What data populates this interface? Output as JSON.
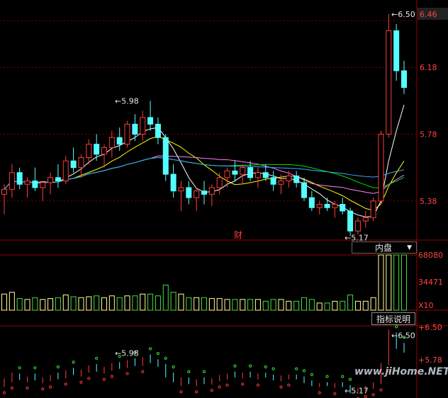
{
  "price_panel": {
    "y_labels": [
      "6.46",
      "6.18",
      "5.78",
      "5.38"
    ],
    "current_label": "6.46",
    "high_annotation": "6.50",
    "peak_annotation": "5.98",
    "low_annotation": "5.17",
    "marker": "财"
  },
  "volume_panel": {
    "dropdown_label": "内盘",
    "y_labels": [
      "68080",
      "34471"
    ],
    "unit": "X10"
  },
  "indicator_panel": {
    "help_button": "指标说明",
    "y_labels": [
      "+6.50",
      "+5.78"
    ],
    "high_annotation": "6.50",
    "peak_annotation": "5.98",
    "low_annotation": "5.17"
  },
  "watermark": "www.jiHome.NET",
  "colors": {
    "up": "#ff3c3c",
    "down": "#54ffff",
    "ma5": "#ffffff",
    "ma10": "#ffff00",
    "ma20": "#ff80ff",
    "ma30": "#00e000",
    "ma60": "#3fa9ff",
    "grid": "#7a0000",
    "vol_up": "#ffff99",
    "vol_down": "#44dd44"
  },
  "chart_data": {
    "type": "candlestick",
    "ylim": [
      5.15,
      6.55
    ],
    "candles": [
      [
        5.42,
        5.48,
        5.3,
        5.45
      ],
      [
        5.45,
        5.6,
        5.4,
        5.55
      ],
      [
        5.55,
        5.58,
        5.45,
        5.48
      ],
      [
        5.48,
        5.52,
        5.4,
        5.5
      ],
      [
        5.5,
        5.58,
        5.44,
        5.46
      ],
      [
        5.46,
        5.5,
        5.38,
        5.49
      ],
      [
        5.49,
        5.55,
        5.42,
        5.52
      ],
      [
        5.52,
        5.6,
        5.46,
        5.5
      ],
      [
        5.5,
        5.65,
        5.48,
        5.62
      ],
      [
        5.62,
        5.7,
        5.55,
        5.58
      ],
      [
        5.58,
        5.66,
        5.52,
        5.64
      ],
      [
        5.64,
        5.75,
        5.6,
        5.72
      ],
      [
        5.72,
        5.78,
        5.62,
        5.66
      ],
      [
        5.66,
        5.72,
        5.58,
        5.7
      ],
      [
        5.7,
        5.8,
        5.64,
        5.76
      ],
      [
        5.76,
        5.82,
        5.68,
        5.72
      ],
      [
        5.72,
        5.86,
        5.7,
        5.84
      ],
      [
        5.84,
        5.9,
        5.74,
        5.78
      ],
      [
        5.78,
        5.92,
        5.74,
        5.88
      ],
      [
        5.88,
        5.98,
        5.8,
        5.84
      ],
      [
        5.84,
        5.88,
        5.72,
        5.76
      ],
      [
        5.76,
        5.78,
        5.5,
        5.54
      ],
      [
        5.54,
        5.6,
        5.4,
        5.44
      ],
      [
        5.44,
        5.5,
        5.32,
        5.46
      ],
      [
        5.46,
        5.5,
        5.36,
        5.4
      ],
      [
        5.4,
        5.46,
        5.32,
        5.44
      ],
      [
        5.44,
        5.5,
        5.36,
        5.42
      ],
      [
        5.42,
        5.48,
        5.35,
        5.46
      ],
      [
        5.46,
        5.55,
        5.42,
        5.52
      ],
      [
        5.52,
        5.58,
        5.46,
        5.56
      ],
      [
        5.56,
        5.62,
        5.5,
        5.54
      ],
      [
        5.54,
        5.6,
        5.48,
        5.58
      ],
      [
        5.58,
        5.62,
        5.5,
        5.52
      ],
      [
        5.52,
        5.58,
        5.46,
        5.55
      ],
      [
        5.55,
        5.6,
        5.5,
        5.52
      ],
      [
        5.52,
        5.56,
        5.44,
        5.48
      ],
      [
        5.48,
        5.54,
        5.42,
        5.5
      ],
      [
        5.5,
        5.56,
        5.46,
        5.53
      ],
      [
        5.53,
        5.56,
        5.46,
        5.49
      ],
      [
        5.49,
        5.52,
        5.38,
        5.4
      ],
      [
        5.4,
        5.44,
        5.32,
        5.34
      ],
      [
        5.34,
        5.38,
        5.3,
        5.36
      ],
      [
        5.36,
        5.4,
        5.32,
        5.34
      ],
      [
        5.34,
        5.38,
        5.28,
        5.36
      ],
      [
        5.36,
        5.4,
        5.3,
        5.32
      ],
      [
        5.32,
        5.34,
        5.17,
        5.2
      ],
      [
        5.2,
        5.28,
        5.18,
        5.26
      ],
      [
        5.26,
        5.32,
        5.22,
        5.28
      ],
      [
        5.28,
        5.4,
        5.26,
        5.38
      ],
      [
        5.38,
        5.8,
        5.36,
        5.78
      ],
      [
        5.78,
        6.5,
        5.76,
        6.4
      ],
      [
        6.4,
        6.44,
        6.1,
        6.16
      ],
      [
        6.16,
        6.22,
        6.02,
        6.06
      ]
    ],
    "volume_scale": [
      0,
      68080
    ]
  }
}
